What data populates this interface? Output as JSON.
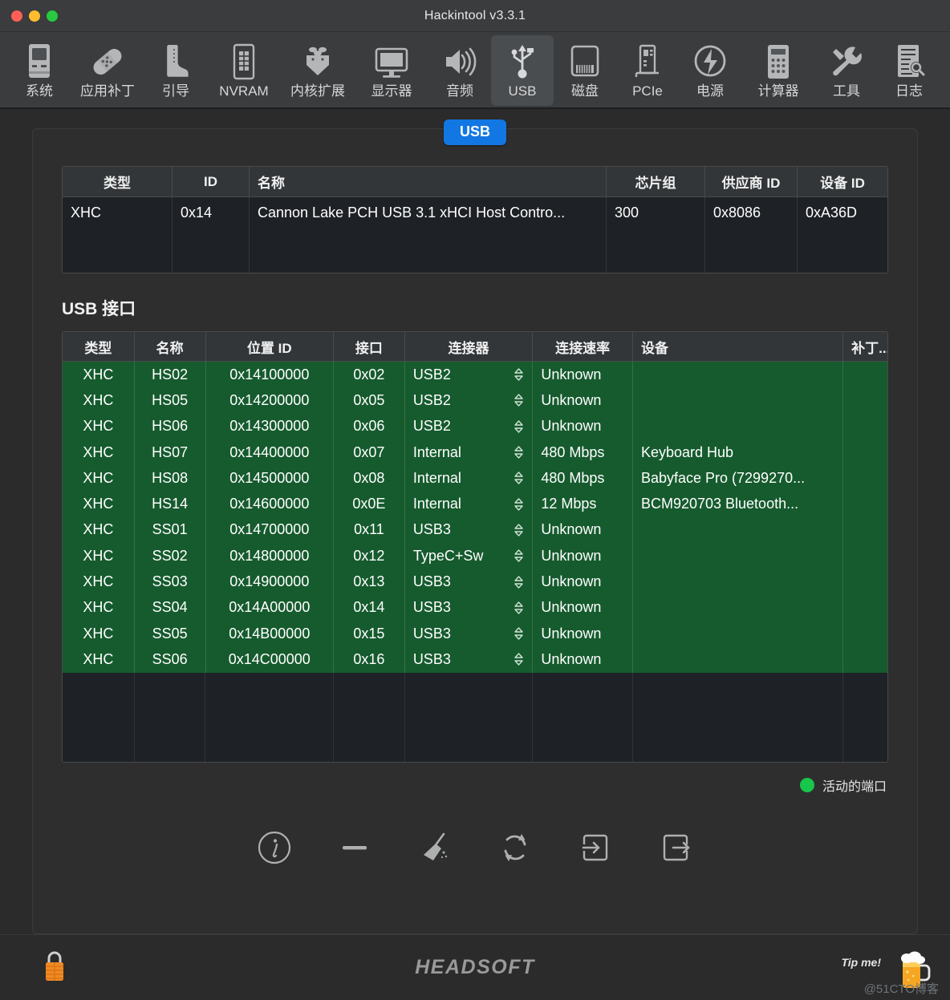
{
  "window": {
    "title": "Hackintool v3.3.1",
    "traffic_lights": [
      "close",
      "minimize",
      "zoom"
    ]
  },
  "toolbar": {
    "items": [
      {
        "label": "系统",
        "icon": "computer-icon",
        "active": false
      },
      {
        "label": "应用补丁",
        "icon": "bandage-icon",
        "active": false
      },
      {
        "label": "引导",
        "icon": "boot-icon",
        "active": false
      },
      {
        "label": "NVRAM",
        "icon": "memory-icon",
        "active": false
      },
      {
        "label": "内核扩展",
        "icon": "kext-icon",
        "active": false
      },
      {
        "label": "显示器",
        "icon": "display-icon",
        "active": false
      },
      {
        "label": "音频",
        "icon": "speaker-icon",
        "active": false
      },
      {
        "label": "USB",
        "icon": "usb-icon",
        "active": true
      },
      {
        "label": "磁盘",
        "icon": "disk-icon",
        "active": false
      },
      {
        "label": "PCIe",
        "icon": "pcie-icon",
        "active": false
      },
      {
        "label": "电源",
        "icon": "power-icon",
        "active": false
      },
      {
        "label": "计算器",
        "icon": "calculator-icon",
        "active": false
      },
      {
        "label": "工具",
        "icon": "wrench-icon",
        "active": false
      },
      {
        "label": "日志",
        "icon": "log-icon",
        "active": false
      }
    ]
  },
  "tab": {
    "label": "USB",
    "accent": "#1277e2"
  },
  "controller_table": {
    "headers": [
      "类型",
      "ID",
      "名称",
      "芯片组",
      "供应商 ID",
      "设备 ID"
    ],
    "rows": [
      {
        "type": "XHC",
        "id": "0x14",
        "name": "Cannon Lake PCH USB 3.1 xHCI Host Contro...",
        "chipset": "300",
        "vendor_id": "0x8086",
        "device_id": "0xA36D"
      }
    ]
  },
  "ports_section": {
    "title": "USB 接口",
    "headers": [
      "类型",
      "名称",
      "位置 ID",
      "接口",
      "连接器",
      "连接速率",
      "设备",
      "补丁..."
    ],
    "rows": [
      {
        "type": "XHC",
        "name": "HS02",
        "location": "0x14100000",
        "port": "0x02",
        "connector": "USB2",
        "speed": "Unknown",
        "device": ""
      },
      {
        "type": "XHC",
        "name": "HS05",
        "location": "0x14200000",
        "port": "0x05",
        "connector": "USB2",
        "speed": "Unknown",
        "device": ""
      },
      {
        "type": "XHC",
        "name": "HS06",
        "location": "0x14300000",
        "port": "0x06",
        "connector": "USB2",
        "speed": "Unknown",
        "device": ""
      },
      {
        "type": "XHC",
        "name": "HS07",
        "location": "0x14400000",
        "port": "0x07",
        "connector": "Internal",
        "speed": "480 Mbps",
        "device": "Keyboard Hub"
      },
      {
        "type": "XHC",
        "name": "HS08",
        "location": "0x14500000",
        "port": "0x08",
        "connector": "Internal",
        "speed": "480 Mbps",
        "device": "Babyface Pro (7299270..."
      },
      {
        "type": "XHC",
        "name": "HS14",
        "location": "0x14600000",
        "port": "0x0E",
        "connector": "Internal",
        "speed": "12 Mbps",
        "device": "BCM920703 Bluetooth..."
      },
      {
        "type": "XHC",
        "name": "SS01",
        "location": "0x14700000",
        "port": "0x11",
        "connector": "USB3",
        "speed": "Unknown",
        "device": ""
      },
      {
        "type": "XHC",
        "name": "SS02",
        "location": "0x14800000",
        "port": "0x12",
        "connector": "TypeC+Sw",
        "speed": "Unknown",
        "device": ""
      },
      {
        "type": "XHC",
        "name": "SS03",
        "location": "0x14900000",
        "port": "0x13",
        "connector": "USB3",
        "speed": "Unknown",
        "device": ""
      },
      {
        "type": "XHC",
        "name": "SS04",
        "location": "0x14A00000",
        "port": "0x14",
        "connector": "USB3",
        "speed": "Unknown",
        "device": ""
      },
      {
        "type": "XHC",
        "name": "SS05",
        "location": "0x14B00000",
        "port": "0x15",
        "connector": "USB3",
        "speed": "Unknown",
        "device": ""
      },
      {
        "type": "XHC",
        "name": "SS06",
        "location": "0x14C00000",
        "port": "0x16",
        "connector": "USB3",
        "speed": "Unknown",
        "device": ""
      }
    ],
    "row_color": "#165b2e"
  },
  "legend": {
    "label": "活动的端口",
    "color": "#17c64a"
  },
  "actions": [
    {
      "icon": "info-icon",
      "name": "info-button"
    },
    {
      "icon": "minus-icon",
      "name": "remove-button"
    },
    {
      "icon": "broom-icon",
      "name": "clear-button"
    },
    {
      "icon": "refresh-icon",
      "name": "refresh-button"
    },
    {
      "icon": "import-icon",
      "name": "import-button"
    },
    {
      "icon": "export-icon",
      "name": "export-button"
    }
  ],
  "statusbar": {
    "lock_icon": "lock-icon",
    "brand": "HEADSOFT",
    "tip_label": "Tip me!",
    "beer_icon": "beer-mug-icon",
    "watermark": "@51CTO博客"
  }
}
